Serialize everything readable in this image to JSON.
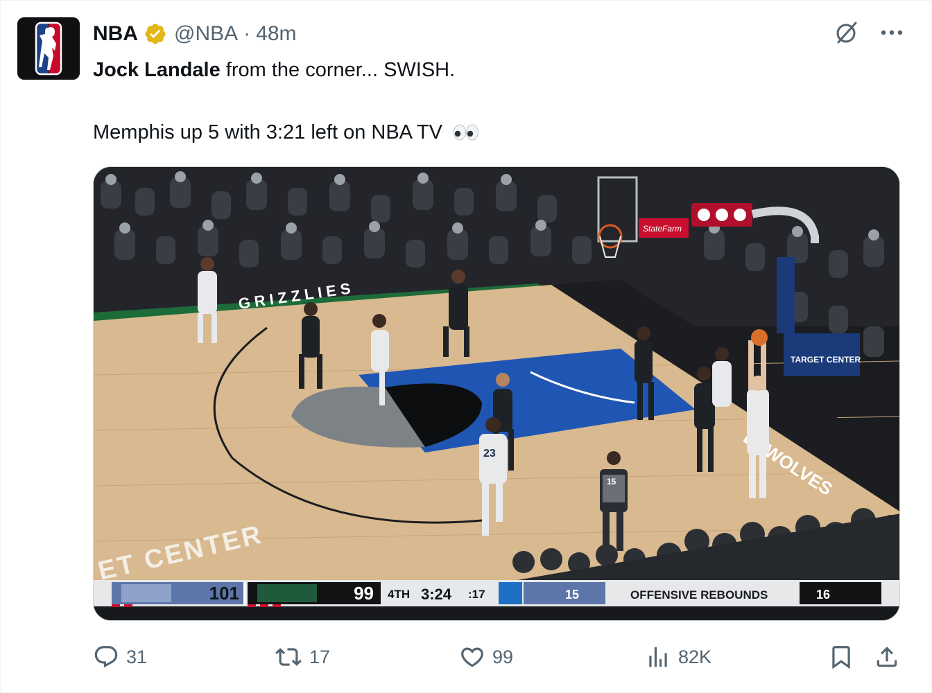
{
  "author": {
    "name": "NBA",
    "handle": "@NBA",
    "separator": "·",
    "time": "48m",
    "verified": true,
    "verified_color": "#e2b719"
  },
  "tweet": {
    "bold_lead": "Jock Landale",
    "text_rest": " from the corner... SWISH.",
    "line2": "Memphis up 5 with 3:21 left on NBA TV",
    "emoji": "eyes-emoji"
  },
  "media": {
    "court_text": "ET CENTER",
    "floor_logo_text": "GRIZZLIES",
    "sideline_text": "ERWOLVES",
    "target_center_label": "TARGET CENTER",
    "statefarm_label": "StateFarm",
    "jersey_numbers": [
      "23",
      "15"
    ],
    "scoreboard": {
      "home_score": "101",
      "away_score": "99",
      "period": "4TH",
      "clock": "3:24",
      "shot_clock": ":17",
      "stat_home": "15",
      "stat_label": "OFFENSIVE REBOUNDS",
      "stat_away": "16"
    }
  },
  "actions": {
    "replies": "31",
    "retweets": "17",
    "likes": "99",
    "views": "82K"
  },
  "colors": {
    "text_primary": "#0f1419",
    "text_secondary": "#536471",
    "court_wood": "#d9b98f",
    "paint_blue": "#1f56b4"
  }
}
